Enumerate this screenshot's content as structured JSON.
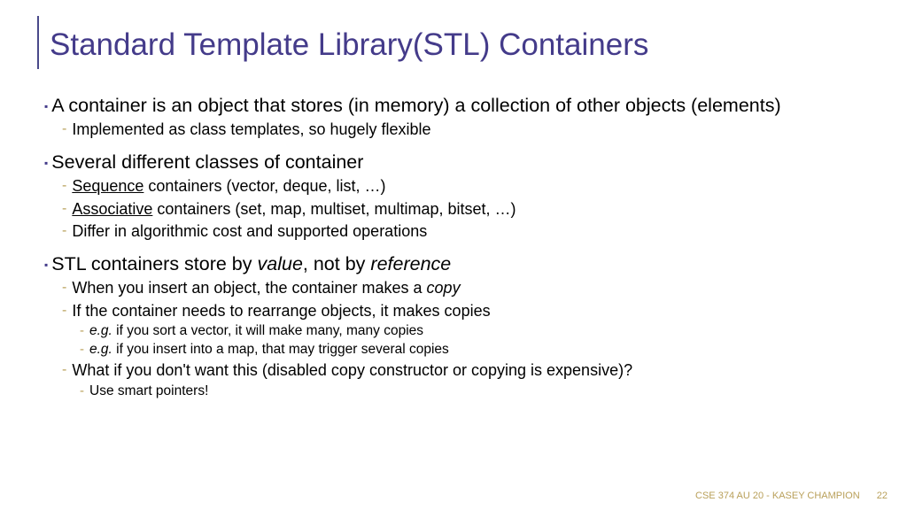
{
  "title": "Standard Template Library(STL)  Containers",
  "groups": [
    {
      "main": "A container is an object that stores (in memory) a collection of other objects (elements)",
      "subs": [
        {
          "type": "l2",
          "text": "Implemented as class templates, so hugely flexible"
        }
      ]
    },
    {
      "main": "Several different classes of container",
      "subs": [
        {
          "type": "l2",
          "html": true,
          "under": "Sequence",
          "rest": " containers (vector, deque, list, …)"
        },
        {
          "type": "l2",
          "html": true,
          "under": "Associative",
          "rest": " containers (set, map, multiset, multimap, bitset, …)"
        },
        {
          "type": "l2",
          "text": "Differ in algorithmic cost and supported operations"
        }
      ]
    },
    {
      "main_html": true,
      "main_pre": "STL containers store by ",
      "main_it1": "value",
      "main_mid": ", not by ",
      "main_it2": "reference",
      "subs": [
        {
          "type": "l2",
          "html": true,
          "pre": "When you insert an object, the container makes a ",
          "it": "copy"
        },
        {
          "type": "l2",
          "text": "If the container needs to rearrange objects, it makes copies"
        },
        {
          "type": "l3",
          "html": true,
          "it": "e.g.",
          "rest": " if you sort a vector, it will make many, many copies"
        },
        {
          "type": "l3",
          "html": true,
          "it": "e.g.",
          "rest": " if you insert into a map, that may trigger several copies"
        },
        {
          "type": "l2",
          "text": "What if you don't want this (disabled copy constructor or copying is expensive)?"
        },
        {
          "type": "l3",
          "text": "Use smart pointers!"
        }
      ]
    }
  ],
  "footer": {
    "course": "CSE 374 AU 20 - KASEY CHAMPION",
    "page": "22"
  }
}
